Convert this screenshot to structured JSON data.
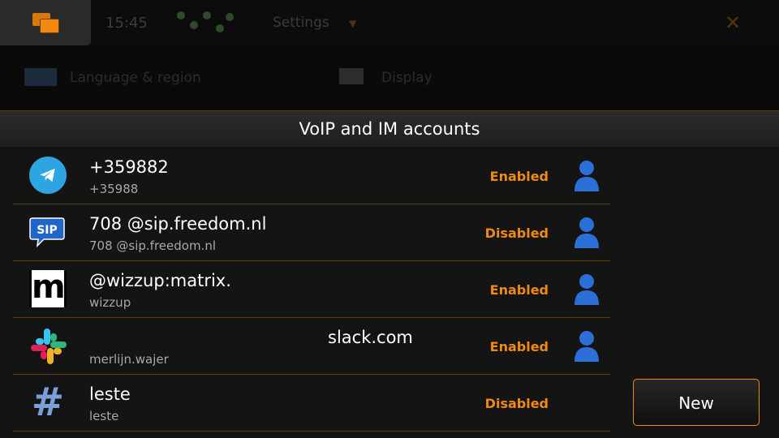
{
  "statusbar": {
    "time": "15:45",
    "title": "Settings"
  },
  "background_row": {
    "item1": "Language & region",
    "item2": "Display"
  },
  "dialog": {
    "title": "VoIP and IM accounts",
    "new_label": "New"
  },
  "accounts": [
    {
      "main": "+359882",
      "sub": "+35988",
      "status": "Enabled",
      "icon": "telegram-icon"
    },
    {
      "main": "708        @sip.freedom.nl",
      "sub": "708          @sip.freedom.nl",
      "status": "Disabled",
      "icon": "sip-icon"
    },
    {
      "main": "@wizzup:matrix.",
      "sub": "wizzup",
      "status": "Enabled",
      "icon": "matrix-icon"
    },
    {
      "main": "slack.com",
      "sub": "merlijn.wajer",
      "status": "Enabled",
      "icon": "slack-icon"
    },
    {
      "main": "leste",
      "sub": "leste",
      "status": "Disabled",
      "icon": "irc-icon"
    }
  ],
  "colors": {
    "accent": "#f08a10",
    "contact": "#2c6fd6",
    "telegram": "#2ca5e0",
    "sip": "#1f66c8"
  }
}
